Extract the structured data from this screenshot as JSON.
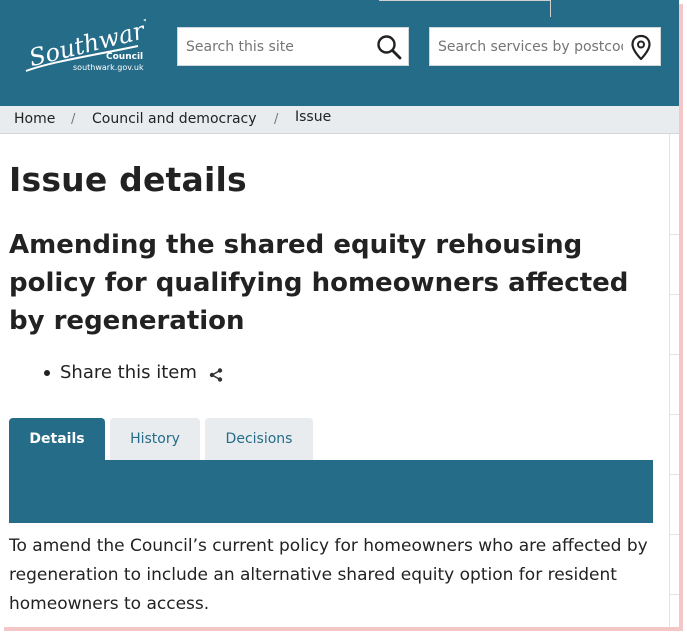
{
  "header": {
    "logo": {
      "wordmark": "Southwark",
      "council": "Council",
      "url_text": "southwark.gov.uk"
    },
    "site_search": {
      "placeholder": "Search this site",
      "icon": "search-icon"
    },
    "postcode_search": {
      "placeholder": "Search services by postcode",
      "icon": "location-pin-icon"
    },
    "brand_color": "#256c89"
  },
  "breadcrumb": {
    "items": [
      {
        "label": "Home"
      },
      {
        "label": "Council and democracy"
      },
      {
        "label": "Issue"
      }
    ],
    "separator": "/"
  },
  "page": {
    "title": "Issue details",
    "issue_title": "Amending the shared equity rehousing policy for qualifying homeowners affected by regeneration",
    "share_label": "Share this item",
    "share_icon": "share-icon"
  },
  "tabs": [
    {
      "label": "Details",
      "active": true
    },
    {
      "label": "History",
      "active": false
    },
    {
      "label": "Decisions",
      "active": false
    }
  ],
  "details": {
    "description": "To amend the Council’s current policy for homeowners who are affected by regeneration to include an alternative shared equity option for resident homeowners to access."
  }
}
